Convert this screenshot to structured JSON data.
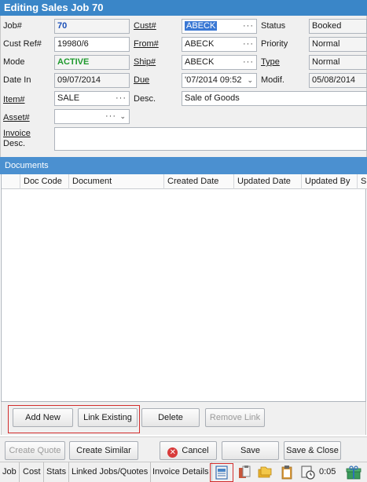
{
  "window": {
    "title": "Editing Sales Job 70"
  },
  "form": {
    "job": {
      "label": "Job#",
      "value": "70"
    },
    "cust": {
      "label": "Cust#",
      "value": "ABECK"
    },
    "status": {
      "label": "Status",
      "value": "Booked"
    },
    "cust_ref": {
      "label": "Cust Ref#",
      "value": "19980/6"
    },
    "from": {
      "label": "From#",
      "value": "ABECK"
    },
    "priority": {
      "label": "Priority",
      "value": "Normal"
    },
    "mode": {
      "label": "Mode",
      "value": "ACTIVE"
    },
    "ship": {
      "label": "Ship#",
      "value": "ABECK"
    },
    "type": {
      "label": "Type",
      "value": "Normal"
    },
    "date_in": {
      "label": "Date In",
      "value": "09/07/2014"
    },
    "due": {
      "label": "Due",
      "value": "'07/2014 09:52"
    },
    "modif": {
      "label": "Modif.",
      "value": "05/08/2014"
    },
    "item": {
      "label": "Item#",
      "value": "SALE"
    },
    "desc": {
      "label": "Desc.",
      "value": "Sale of Goods"
    },
    "asset": {
      "label": "Asset#",
      "value": ""
    },
    "invoice_desc": {
      "label_line1": "Invoice",
      "label_line2": "Desc.",
      "value": ""
    },
    "lookup_glyph": "···",
    "dropdown_glyph": "⌄"
  },
  "documents": {
    "header": "Documents",
    "columns": [
      "Doc Code",
      "Document",
      "Created Date",
      "Updated Date",
      "Updated By",
      "Si"
    ],
    "rows": [],
    "buttons": {
      "add_new": "Add New",
      "link_existing": "Link Existing",
      "delete": "Delete",
      "remove_link": "Remove Link"
    }
  },
  "actions": {
    "create_quote": "Create Quote",
    "create_similar": "Create Similar",
    "cancel": "Cancel",
    "save": "Save",
    "save_close": "Save & Close"
  },
  "tabs": [
    "Job",
    "Cost",
    "Stats",
    "Linked Jobs/Quotes",
    "Invoice Details"
  ],
  "timer": "0:05",
  "colors": {
    "title_bar": "#3a86c8",
    "section_header": "#4b90d0",
    "job_number": "#1a4fb8",
    "mode_active": "#1f9a2e",
    "highlight_box": "#d22c2c"
  },
  "icons": [
    "documents-icon",
    "clipboard-copy-icon",
    "folders-icon",
    "clipboard-icon",
    "time-icon",
    "gift-icon"
  ]
}
